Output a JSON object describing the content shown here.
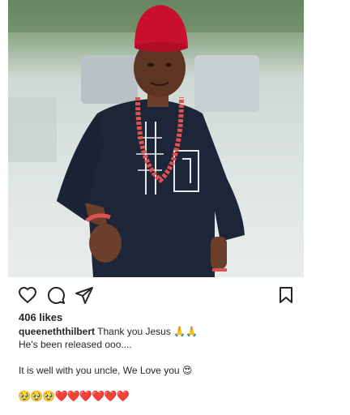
{
  "post": {
    "image_description": "photo",
    "likes": "406 likes",
    "username": "queeneththilbert",
    "caption_text": "Thank you Jesus 🙏🙏",
    "caption_line2": "He's been released ooo....",
    "caption_line3": "It is well with you uncle, We Love you 😍",
    "emoji_line": "🥹🥹🥹❤️❤️❤️❤️❤️❤️",
    "timestamp": "..."
  },
  "actions": {
    "like": "heart-icon",
    "comment": "comment-icon",
    "share": "send-icon",
    "save": "bookmark-icon"
  },
  "colors": {
    "text": "#262626",
    "fez": "#c8102e",
    "beads": "#e0524f",
    "attire": "#1c2638"
  }
}
